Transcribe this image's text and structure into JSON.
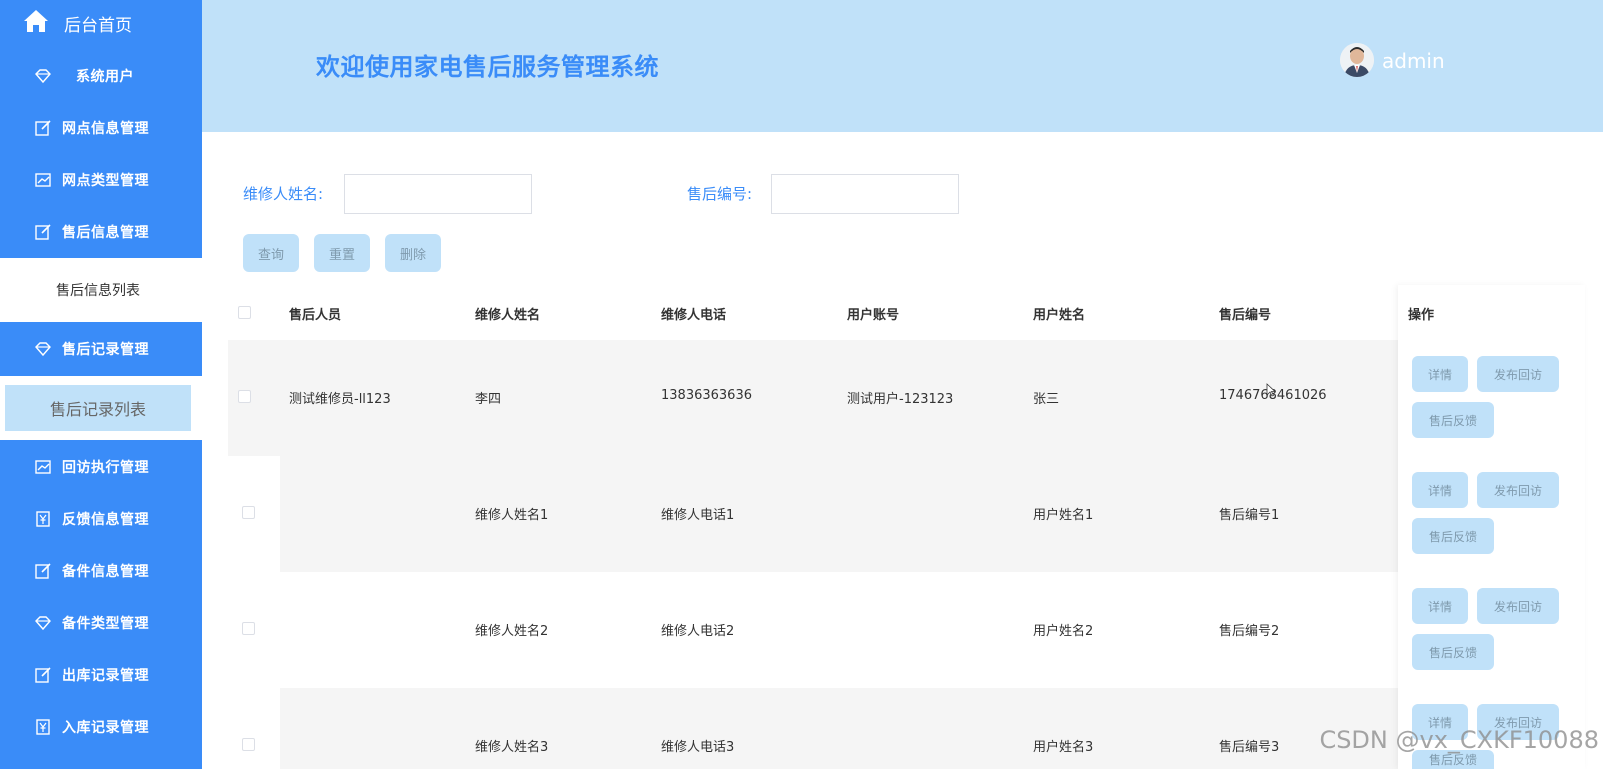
{
  "sidebar": {
    "home": "后台首页",
    "items": [
      {
        "label": "系统用户",
        "icon": "diamond-icon"
      },
      {
        "label": "网点信息管理",
        "icon": "edit-icon"
      },
      {
        "label": "网点类型管理",
        "icon": "chart-icon"
      },
      {
        "label": "售后信息管理",
        "icon": "edit-icon"
      },
      {
        "label": "售后记录管理",
        "icon": "diamond-icon"
      },
      {
        "label": "回访执行管理",
        "icon": "chart-icon"
      },
      {
        "label": "反馈信息管理",
        "icon": "yen-icon"
      },
      {
        "label": "备件信息管理",
        "icon": "edit-icon"
      },
      {
        "label": "备件类型管理",
        "icon": "diamond-icon"
      },
      {
        "label": "出库记录管理",
        "icon": "edit-icon"
      },
      {
        "label": "入库记录管理",
        "icon": "yen-icon"
      }
    ],
    "sub_after_aftersale_info": "售后信息列表",
    "sub_after_aftersale_record": "售后记录列表"
  },
  "header": {
    "title": "欢迎使用家电售后服务管理系统",
    "user": "admin"
  },
  "search": {
    "repairer_name_label": "维修人姓名:",
    "aftersale_no_label": "售后编号:",
    "repairer_name_value": "",
    "aftersale_no_value": "",
    "query_btn": "查询",
    "reset_btn": "重置",
    "delete_btn": "删除"
  },
  "table": {
    "headers": [
      "售后人员",
      "维修人姓名",
      "维修人电话",
      "用户账号",
      "用户姓名",
      "售后编号",
      "操作"
    ],
    "rows": [
      {
        "staff": "测试维修员-ll123",
        "repairer": "李四",
        "phone": "13836363636",
        "account": "测试用户-123123",
        "username": "张三",
        "no": "1746768461026"
      },
      {
        "staff": "",
        "repairer": "维修人姓名1",
        "phone": "维修人电话1",
        "account": "",
        "username": "用户姓名1",
        "no": "售后编号1"
      },
      {
        "staff": "",
        "repairer": "维修人姓名2",
        "phone": "维修人电话2",
        "account": "",
        "username": "用户姓名2",
        "no": "售后编号2"
      },
      {
        "staff": "",
        "repairer": "维修人姓名3",
        "phone": "维修人电话3",
        "account": "",
        "username": "用户姓名3",
        "no": "售后编号3"
      }
    ],
    "op_detail": "详情",
    "op_publish": "发布回访",
    "op_feedback": "售后反馈"
  },
  "watermark": "CSDN @vx_CXKF10088",
  "colors": {
    "primary": "#3a8cf8",
    "light": "#c0e1f9"
  }
}
